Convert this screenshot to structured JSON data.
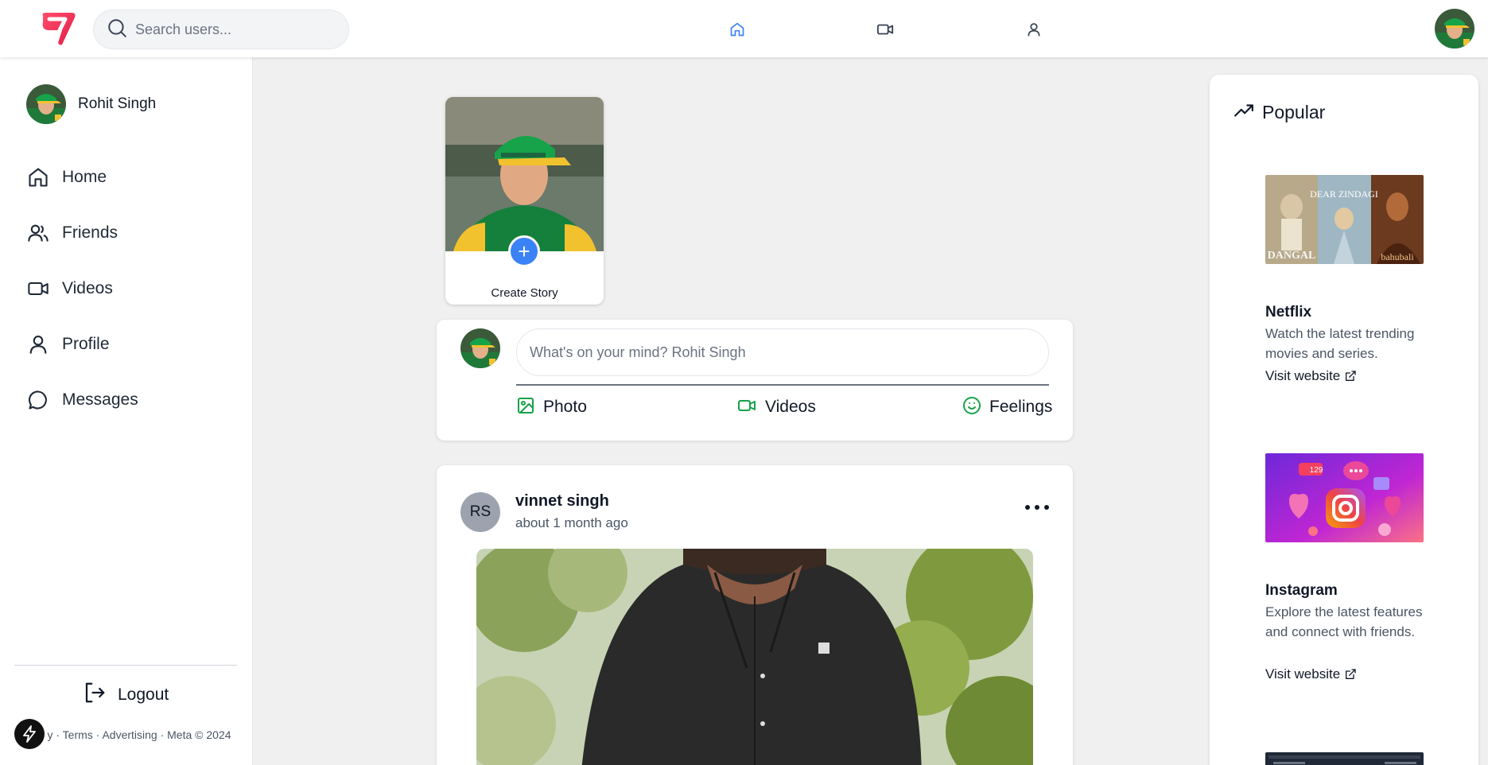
{
  "header": {
    "search_placeholder": "Search users...",
    "nav": [
      "home-icon",
      "video-icon",
      "user-icon"
    ],
    "active_color": "#3b82f6"
  },
  "sidebar": {
    "user_name": "Rohit Singh",
    "items": [
      {
        "label": "Home",
        "icon": "home-icon"
      },
      {
        "label": "Friends",
        "icon": "users-icon"
      },
      {
        "label": "Videos",
        "icon": "video-icon"
      },
      {
        "label": "Profile",
        "icon": "user-icon"
      },
      {
        "label": "Messages",
        "icon": "message-icon"
      }
    ],
    "logout_label": "Logout",
    "footer_text": "y · Terms · Advertising · Meta © 2024"
  },
  "story": {
    "caption": "Create Story",
    "plus": "+"
  },
  "composer": {
    "placeholder": "What's on your mind? Rohit Singh",
    "actions": [
      {
        "label": "Photo",
        "icon": "image-icon"
      },
      {
        "label": "Videos",
        "icon": "video-icon"
      },
      {
        "label": "Feelings",
        "icon": "smile-icon"
      }
    ],
    "action_color": "#16a34a"
  },
  "post": {
    "avatar_initials": "RS",
    "author": "vinnet singh",
    "time": "about 1 month ago"
  },
  "popular": {
    "title": "Popular",
    "cards": [
      {
        "poster_text": [
          "DANGAL",
          "DEAR ZINDAGI",
          "bahubali"
        ],
        "title": "Netflix",
        "description": "Watch the latest trending movies and series.",
        "link": "Visit website"
      },
      {
        "poster_text": [
          "129"
        ],
        "title": "Instagram",
        "description": "Explore the latest features and connect with friends.",
        "link": "Visit website"
      }
    ]
  }
}
